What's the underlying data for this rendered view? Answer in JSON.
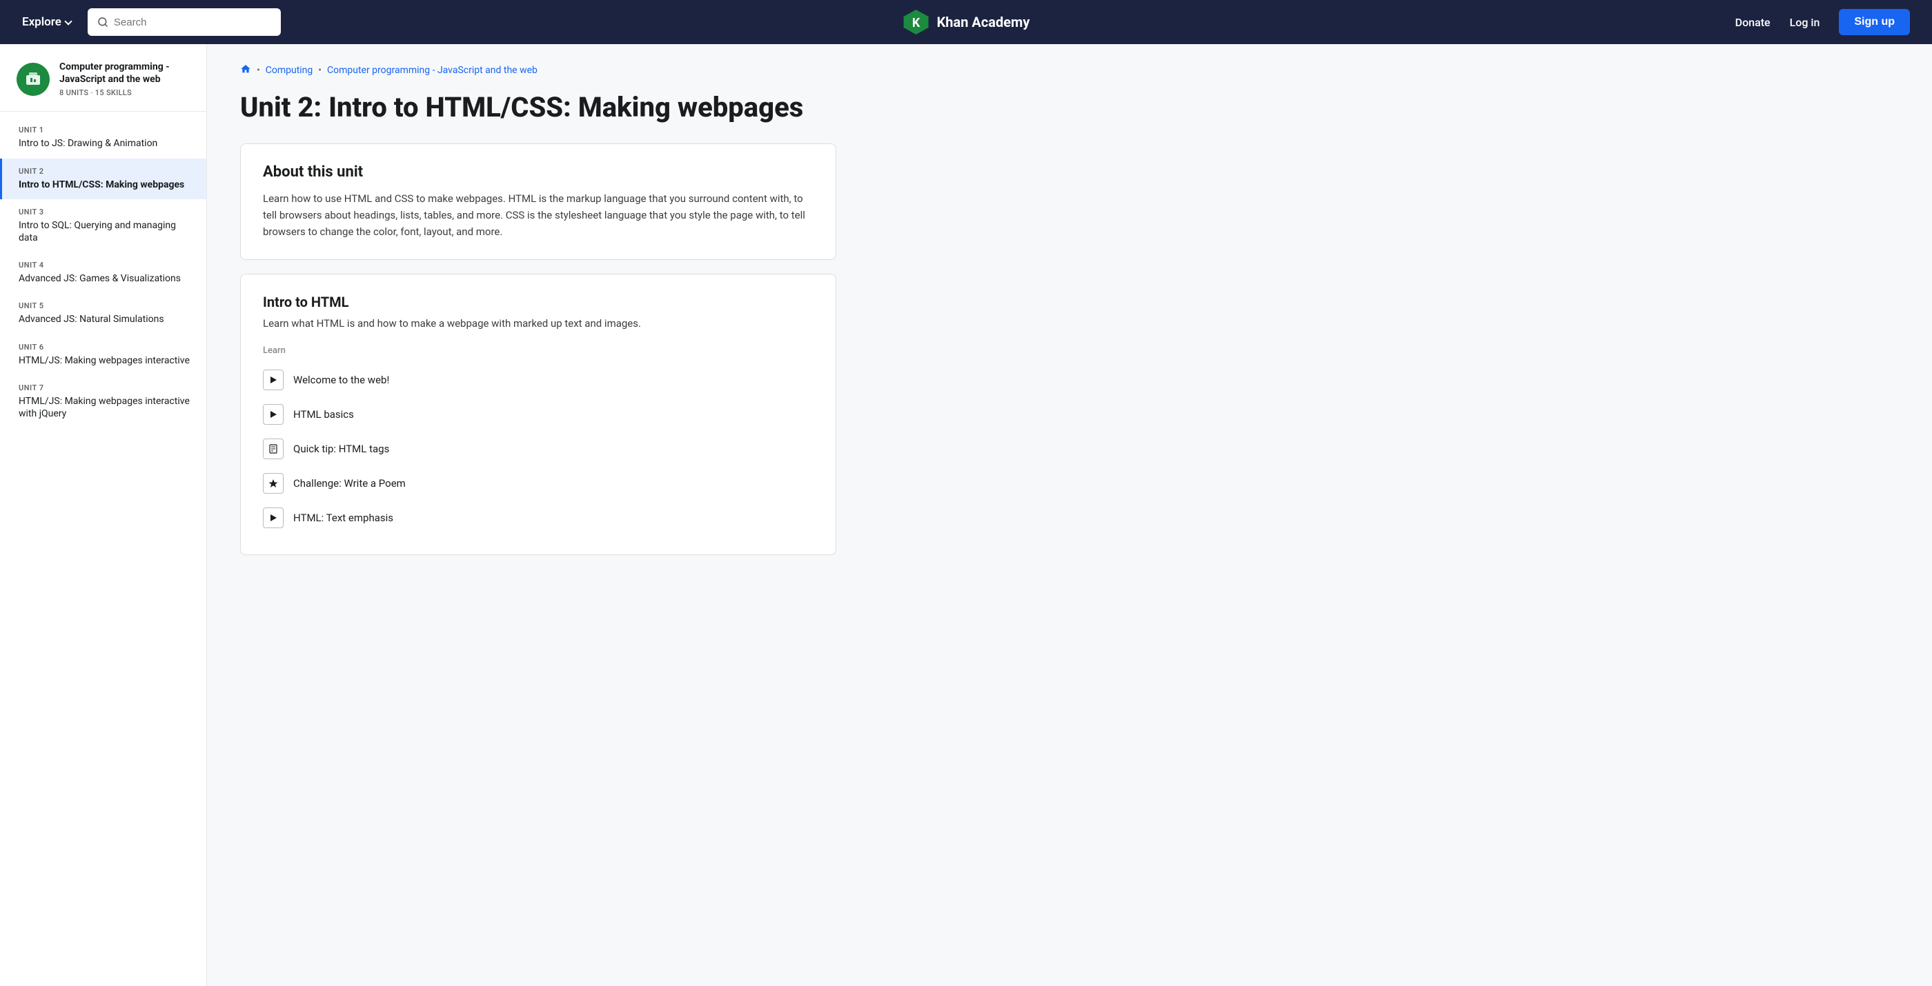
{
  "navbar": {
    "explore_label": "Explore",
    "search_placeholder": "Search",
    "brand_name": "Khan Academy",
    "donate_label": "Donate",
    "login_label": "Log in",
    "signup_label": "Sign up"
  },
  "breadcrumb": {
    "home_icon": "home",
    "computing_label": "Computing",
    "course_label": "Computer programming - JavaScript and the web"
  },
  "page": {
    "title": "Unit 2: Intro to HTML/CSS: Making webpages"
  },
  "sidebar": {
    "course_title": "Computer programming - JavaScript and the web",
    "course_meta": "8 UNITS · 15 SKILLS",
    "units": [
      {
        "label": "UNIT 1",
        "name": "Intro to JS: Drawing & Animation",
        "active": false
      },
      {
        "label": "UNIT 2",
        "name": "Intro to HTML/CSS: Making webpages",
        "active": true
      },
      {
        "label": "UNIT 3",
        "name": "Intro to SQL: Querying and managing data",
        "active": false
      },
      {
        "label": "UNIT 4",
        "name": "Advanced JS: Games & Visualizations",
        "active": false
      },
      {
        "label": "UNIT 5",
        "name": "Advanced JS: Natural Simulations",
        "active": false
      },
      {
        "label": "UNIT 6",
        "name": "HTML/JS: Making webpages interactive",
        "active": false
      },
      {
        "label": "UNIT 7",
        "name": "HTML/JS: Making webpages interactive with jQuery",
        "active": false
      }
    ]
  },
  "about": {
    "title": "About this unit",
    "text": "Learn how to use HTML and CSS to make webpages. HTML is the markup language that you surround content with, to tell browsers about headings, lists, tables, and more. CSS is the stylesheet language that you style the page with, to tell browsers to change the color, font, layout, and more."
  },
  "section": {
    "title": "Intro to HTML",
    "description": "Learn what HTML is and how to make a webpage with marked up text and images.",
    "learn_label": "Learn",
    "lessons": [
      {
        "type": "video",
        "name": "Welcome to the web!"
      },
      {
        "type": "video",
        "name": "HTML basics"
      },
      {
        "type": "article",
        "name": "Quick tip: HTML tags"
      },
      {
        "type": "challenge",
        "name": "Challenge: Write a Poem"
      },
      {
        "type": "video",
        "name": "HTML: Text emphasis"
      }
    ]
  }
}
